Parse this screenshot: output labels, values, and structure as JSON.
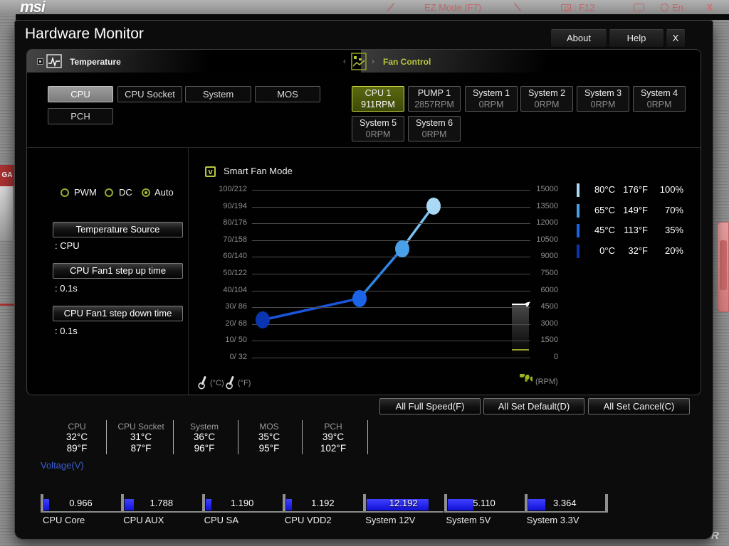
{
  "background": {
    "logo": "msi",
    "ez_mode": "EZ Mode (F7)",
    "screenshot_key": ": F12",
    "language": "En",
    "close": "X",
    "left_badge": "GA",
    "bottom_right_letter": "R"
  },
  "window": {
    "title": "Hardware Monitor",
    "buttons": {
      "about": "About",
      "help": "Help",
      "close": "X"
    }
  },
  "sections": {
    "temperature": {
      "label": "Temperature",
      "tabs": [
        "CPU",
        "CPU Socket",
        "System",
        "MOS",
        "PCH"
      ],
      "selected_tab": "CPU"
    },
    "fan_control": {
      "label": "Fan Control",
      "fans": [
        {
          "name": "CPU 1",
          "rpm": "911RPM",
          "selected": true
        },
        {
          "name": "PUMP 1",
          "rpm": "2857RPM",
          "selected": false
        },
        {
          "name": "System 1",
          "rpm": "0RPM",
          "selected": false
        },
        {
          "name": "System 2",
          "rpm": "0RPM",
          "selected": false
        },
        {
          "name": "System 3",
          "rpm": "0RPM",
          "selected": false
        },
        {
          "name": "System 4",
          "rpm": "0RPM",
          "selected": false
        },
        {
          "name": "System 5",
          "rpm": "0RPM",
          "selected": false
        },
        {
          "name": "System 6",
          "rpm": "0RPM",
          "selected": false
        }
      ]
    }
  },
  "controls": {
    "modes": [
      {
        "label": "PWM",
        "selected": false
      },
      {
        "label": "DC",
        "selected": false
      },
      {
        "label": "Auto",
        "selected": true
      }
    ],
    "settings": [
      {
        "button": "Temperature Source",
        "value": ": CPU"
      },
      {
        "button": "CPU Fan1 step up time",
        "value": ": 0.1s"
      },
      {
        "button": "CPU Fan1 step down time",
        "value": ": 0.1s"
      }
    ]
  },
  "chart_data": {
    "type": "line",
    "title": "Smart Fan Mode",
    "checkbox_checked": true,
    "y_left_axis": "Temperature (C/F)",
    "y_right_axis": "Fan speed (RPM)",
    "ylim_left": [
      0,
      100
    ],
    "ylim_right": [
      0,
      15000
    ],
    "grid": true,
    "y_left_labels": [
      "100/212",
      "90/194",
      "80/176",
      "70/158",
      "60/140",
      "50/122",
      "40/104",
      "30/ 86",
      "20/ 68",
      "10/ 50",
      "0/ 32"
    ],
    "y_right_labels": [
      "15000",
      "13500",
      "12000",
      "10500",
      "9000",
      "7500",
      "6000",
      "4500",
      "3000",
      "1500",
      "0"
    ],
    "x_axis_units": [
      "(°C)",
      "(°F)"
    ],
    "rpm_unit": "(RPM)",
    "curve_points": [
      {
        "temp_c": 0,
        "temp_f": 32,
        "percent": 20,
        "x_frac": 0.039,
        "y_percent": 22.5,
        "color": "#0a35b0"
      },
      {
        "temp_c": 45,
        "temp_f": 113,
        "percent": 35,
        "x_frac": 0.386,
        "y_percent": 35.3,
        "color": "#1b64e8"
      },
      {
        "temp_c": 65,
        "temp_f": 149,
        "percent": 70,
        "x_frac": 0.539,
        "y_percent": 65.0,
        "color": "#4aa0e8"
      },
      {
        "temp_c": 80,
        "temp_f": 176,
        "percent": 100,
        "x_frac": 0.651,
        "y_percent": 90.3,
        "color": "#a9d9f5"
      }
    ],
    "segment_colors": [
      "#1c55dd",
      "#2f86e6",
      "#79c2f2"
    ],
    "legend": [
      {
        "temp_c": "80°C",
        "temp_f": "176°F",
        "percent": "100%",
        "color": "#a9d9f5"
      },
      {
        "temp_c": "65°C",
        "temp_f": "149°F",
        "percent": "70%",
        "color": "#4aa0e8"
      },
      {
        "temp_c": "45°C",
        "temp_f": "113°F",
        "percent": "35%",
        "color": "#1b64e8"
      },
      {
        "temp_c": "0°C",
        "temp_f": "32°F",
        "percent": "20%",
        "color": "#0a35b0"
      }
    ]
  },
  "actions": [
    "All Full Speed(F)",
    "All Set Default(D)",
    "All Set Cancel(C)"
  ],
  "readings": {
    "temperatures": [
      {
        "label": "CPU",
        "c": "32°C",
        "f": "89°F"
      },
      {
        "label": "CPU Socket",
        "c": "31°C",
        "f": "87°F"
      },
      {
        "label": "System",
        "c": "36°C",
        "f": "96°F"
      },
      {
        "label": "MOS",
        "c": "35°C",
        "f": "95°F"
      },
      {
        "label": "PCH",
        "c": "39°C",
        "f": "102°F"
      }
    ],
    "voltage_title": "Voltage(V)",
    "voltages": [
      {
        "label": "CPU Core",
        "value": "0.966"
      },
      {
        "label": "CPU AUX",
        "value": "1.788"
      },
      {
        "label": "CPU SA",
        "value": "1.190"
      },
      {
        "label": "CPU VDD2",
        "value": "1.192"
      },
      {
        "label": "System 12V",
        "value": "12.192"
      },
      {
        "label": "System 5V",
        "value": "5.110"
      },
      {
        "label": "System 3.3V",
        "value": "3.364"
      }
    ]
  },
  "colors": {
    "accent_olive": "#b9c73c",
    "voltage_bar_blue": "#2222ee",
    "voltage_title_blue": "#3d5fd0",
    "background_red": "#c06666"
  }
}
